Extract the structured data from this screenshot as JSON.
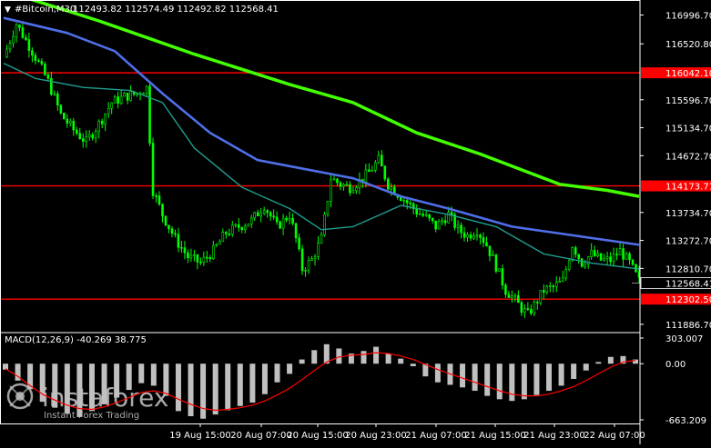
{
  "header": {
    "arrow": "▼",
    "symbol": "#Bitcoin,M30",
    "ohlc": "112493.82 112574.49 112492.82 112568.41"
  },
  "macd_label": "MACD(12,26,9) -40.269 38.775",
  "watermark": {
    "brand": "instaforex",
    "tagline": "Instant Forex Trading"
  },
  "colors": {
    "background": "#000000",
    "candles": "#00ff00",
    "axis_text": "#ffffff",
    "hline": "#ff0000",
    "ma_long": "#44ff00",
    "ma_mid": "#4f6ee8",
    "ma_short": "#1f9e8e",
    "macd_hist": "#c0c0c0",
    "macd_signal": "#ff0000"
  },
  "chart_data": [
    {
      "type": "candlestick",
      "timeframe": "M30",
      "y_ticks": [
        116996.7,
        116520.8,
        115596.7,
        115134.7,
        114672.7,
        113734.7,
        113272.7,
        112810.7,
        111886.7
      ],
      "ylim": [
        111780,
        117170
      ],
      "x_ticks": [
        "19 Aug 15:00",
        "20 Aug 07:00",
        "20 Aug 15:00",
        "20 Aug 23:00",
        "21 Aug 07:00",
        "21 Aug 15:00",
        "21 Aug 23:00",
        "22 Aug 07:00"
      ],
      "last_price": 112568.41,
      "horizontal_levels": [
        116042.1,
        114173.71,
        112302.5
      ],
      "close_path": [
        [
          0,
          116300
        ],
        [
          4,
          116850
        ],
        [
          9,
          116400
        ],
        [
          14,
          115900
        ],
        [
          18,
          115350
        ],
        [
          22,
          115100
        ],
        [
          26,
          114900
        ],
        [
          30,
          115200
        ],
        [
          34,
          115550
        ],
        [
          38,
          115650
        ],
        [
          42,
          115700
        ],
        [
          45,
          115800
        ],
        [
          47,
          114100
        ],
        [
          50,
          113700
        ],
        [
          54,
          113300
        ],
        [
          58,
          113000
        ],
        [
          62,
          112900
        ],
        [
          66,
          113100
        ],
        [
          70,
          113400
        ],
        [
          74,
          113500
        ],
        [
          78,
          113600
        ],
        [
          82,
          113850
        ],
        [
          86,
          113500
        ],
        [
          90,
          113700
        ],
        [
          92,
          113300
        ],
        [
          94,
          112800
        ],
        [
          97,
          112950
        ],
        [
          100,
          113300
        ],
        [
          103,
          114300
        ],
        [
          106,
          114200
        ],
        [
          109,
          114150
        ],
        [
          112,
          114250
        ],
        [
          115,
          114400
        ],
        [
          118,
          114600
        ],
        [
          121,
          114200
        ],
        [
          124,
          114050
        ],
        [
          127,
          113900
        ],
        [
          130,
          113750
        ],
        [
          133,
          113650
        ],
        [
          136,
          113500
        ],
        [
          140,
          113700
        ],
        [
          143,
          113450
        ],
        [
          146,
          113350
        ],
        [
          149,
          113450
        ],
        [
          152,
          113200
        ],
        [
          155,
          112850
        ],
        [
          158,
          112450
        ],
        [
          160,
          112350
        ],
        [
          163,
          112150
        ],
        [
          165,
          112050
        ],
        [
          167,
          112200
        ],
        [
          170,
          112450
        ],
        [
          173,
          112500
        ],
        [
          176,
          112600
        ],
        [
          179,
          113200
        ],
        [
          182,
          112900
        ],
        [
          185,
          113050
        ],
        [
          188,
          112950
        ],
        [
          191,
          112950
        ],
        [
          194,
          113100
        ],
        [
          197,
          112900
        ],
        [
          200,
          112600
        ]
      ],
      "ma_long": [
        [
          0,
          117400
        ],
        [
          30,
          116900
        ],
        [
          60,
          116350
        ],
        [
          90,
          115850
        ],
        [
          110,
          115550
        ],
        [
          130,
          115050
        ],
        [
          150,
          114700
        ],
        [
          165,
          114400
        ],
        [
          175,
          114200
        ],
        [
          190,
          114100
        ],
        [
          200,
          114000
        ]
      ],
      "ma_mid": [
        [
          0,
          116950
        ],
        [
          20,
          116700
        ],
        [
          35,
          116400
        ],
        [
          50,
          115700
        ],
        [
          65,
          115050
        ],
        [
          80,
          114600
        ],
        [
          95,
          114450
        ],
        [
          110,
          114300
        ],
        [
          125,
          114000
        ],
        [
          140,
          113800
        ],
        [
          160,
          113500
        ],
        [
          180,
          113350
        ],
        [
          200,
          113200
        ]
      ],
      "ma_short": [
        [
          0,
          116200
        ],
        [
          10,
          115950
        ],
        [
          25,
          115800
        ],
        [
          40,
          115750
        ],
        [
          50,
          115550
        ],
        [
          60,
          114800
        ],
        [
          75,
          114150
        ],
        [
          90,
          113800
        ],
        [
          100,
          113450
        ],
        [
          110,
          113500
        ],
        [
          125,
          113850
        ],
        [
          140,
          113700
        ],
        [
          155,
          113500
        ],
        [
          170,
          113050
        ],
        [
          185,
          112900
        ],
        [
          200,
          112800
        ]
      ],
      "macd": {
        "label": "MACD(12,26,9)",
        "main": -40.269,
        "signal": 38.775,
        "y_ticks": [
          303.007,
          0.0,
          -663.209
        ],
        "ylim": [
          -663.209,
          303.007
        ],
        "histogram": [
          -70,
          -200,
          -300,
          -450,
          -520,
          -590,
          -630,
          -560,
          -480,
          -400,
          -310,
          -230,
          -260,
          -380,
          -560,
          -620,
          -650,
          -600,
          -550,
          -500,
          -460,
          -360,
          -220,
          -120,
          50,
          160,
          230,
          180,
          120,
          150,
          200,
          120,
          60,
          -30,
          -150,
          -220,
          -250,
          -280,
          -320,
          -380,
          -420,
          -440,
          -420,
          -370,
          -320,
          -260,
          -180,
          -80,
          20,
          80,
          90,
          50
        ],
        "signal_line": [
          -60,
          -150,
          -260,
          -360,
          -430,
          -490,
          -530,
          -540,
          -510,
          -460,
          -400,
          -340,
          -320,
          -350,
          -420,
          -480,
          -530,
          -550,
          -540,
          -520,
          -490,
          -440,
          -370,
          -290,
          -190,
          -80,
          20,
          80,
          100,
          110,
          130,
          120,
          90,
          50,
          -10,
          -70,
          -120,
          -170,
          -220,
          -270,
          -320,
          -360,
          -380,
          -380,
          -360,
          -320,
          -270,
          -200,
          -120,
          -40,
          20,
          40
        ]
      }
    }
  ]
}
